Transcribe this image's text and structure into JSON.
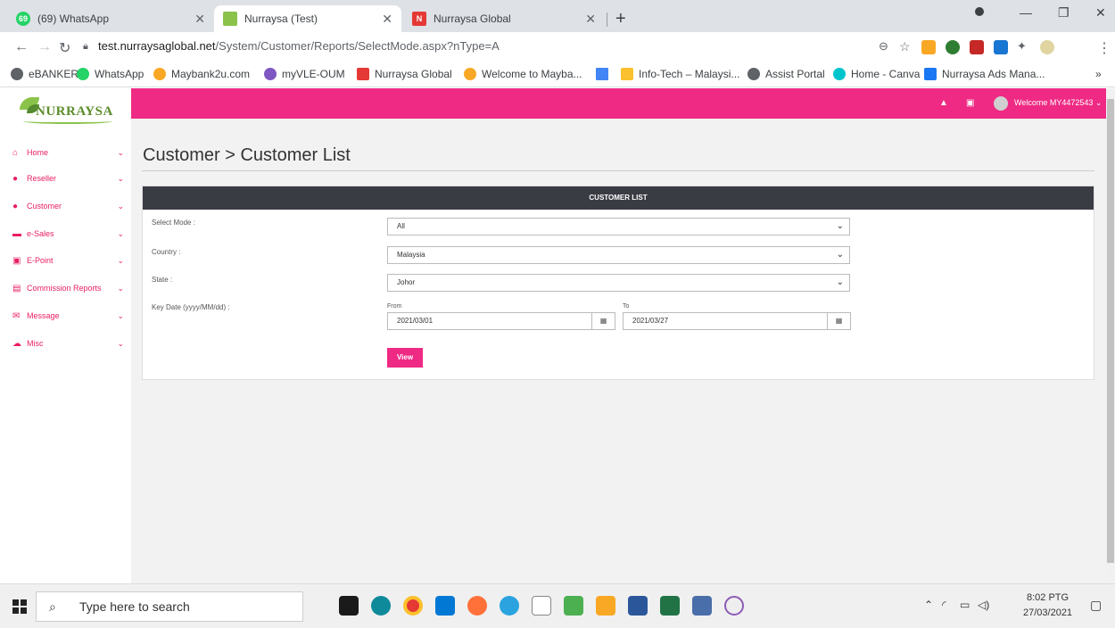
{
  "browser": {
    "tabs": [
      {
        "title": "(69) WhatsApp",
        "fav_text": "69",
        "fav_color": "#25d366"
      },
      {
        "title": "Nurraysa (Test)",
        "fav_text": "",
        "fav_color": "#8bc34a"
      },
      {
        "title": "Nurraysa Global",
        "fav_text": "N",
        "fav_color": "#e53935"
      }
    ],
    "new_tab_icon": "plus-icon",
    "url_host": "test.nurraysaglobal.net",
    "url_path": "/System/Customer/Reports/SelectMode.aspx?nType=A",
    "bookmarks": [
      {
        "label": "eBANKER",
        "color": "#5f6368"
      },
      {
        "label": "WhatsApp",
        "color": "#25d366"
      },
      {
        "label": "Maybank2u.com",
        "color": "#f9a825"
      },
      {
        "label": "myVLE-OUM",
        "color": "#7e57c2"
      },
      {
        "label": "Nurraysa Global",
        "color": "#e53935"
      },
      {
        "label": "Welcome to Mayba...",
        "color": "#f9a825"
      },
      {
        "label": "",
        "color": "#4285f4"
      },
      {
        "label": "Info-Tech – Malaysi...",
        "color": "#fbc02d"
      },
      {
        "label": "Assist Portal",
        "color": "#5f6368"
      },
      {
        "label": "Home - Canva",
        "color": "#00c4cc"
      },
      {
        "label": "Nurraysa Ads Mana...",
        "color": "#1877f2"
      }
    ],
    "bookmarks_more": "»"
  },
  "app": {
    "brand": "NURRAYSA",
    "accent": "#ef2a84",
    "welcome": "Welcome MY4472543",
    "sidebar": [
      {
        "label": "Home",
        "icon": "home-icon",
        "glyph": "⌂"
      },
      {
        "label": "Reseller",
        "icon": "user-icon",
        "glyph": "●"
      },
      {
        "label": "Customer",
        "icon": "users-icon",
        "glyph": "●"
      },
      {
        "label": "e-Sales",
        "icon": "cart-icon",
        "glyph": "▬"
      },
      {
        "label": "E-Point",
        "icon": "card-icon",
        "glyph": "▣"
      },
      {
        "label": "Commission Reports",
        "icon": "report-icon",
        "glyph": "▤"
      },
      {
        "label": "Message",
        "icon": "envelope-icon",
        "glyph": "✉"
      },
      {
        "label": "Misc",
        "icon": "cloud-icon",
        "glyph": "☁"
      }
    ],
    "page_title": "Customer > Customer List",
    "panel_title": "CUSTOMER LIST",
    "form": {
      "select_mode_label": "Select Mode :",
      "select_mode_value": "All",
      "country_label": "Country :",
      "country_value": "Malaysia",
      "state_label": "State :",
      "state_value": "Johor",
      "key_date_label": "Key Date (yyyy/MM/dd) :",
      "from_label": "From",
      "from_value": "2021/03/01",
      "to_label": "To",
      "to_value": "2021/03/27",
      "view_label": "View"
    }
  },
  "taskbar": {
    "search_placeholder": "Type here to search",
    "time": "8:02 PTG",
    "date": "27/03/2021"
  }
}
